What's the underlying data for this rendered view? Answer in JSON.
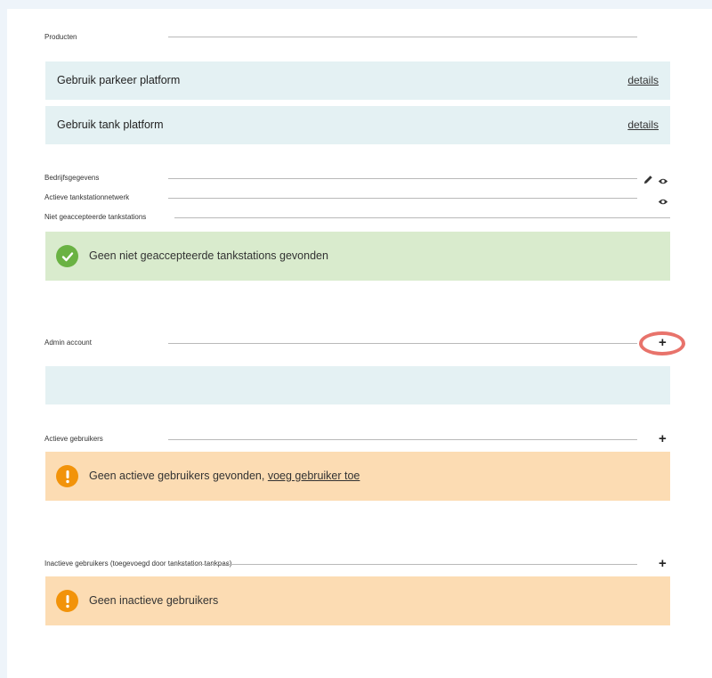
{
  "products": {
    "label": "Producten",
    "items": [
      {
        "name": "Gebruik parkeer platform",
        "link": "details"
      },
      {
        "name": "Gebruik tank platform",
        "link": "details"
      }
    ]
  },
  "company": {
    "label": "Bedrijfsgegevens"
  },
  "network": {
    "label": "Actieve tankstationnetwerk"
  },
  "unaccepted": {
    "label": "Niet geaccepteerde tankstations",
    "message": "Geen niet geaccepteerde tankstations gevonden"
  },
  "admin": {
    "label": "Admin account"
  },
  "active_users": {
    "label": "Actieve gebruikers",
    "message": "Geen actieve gebruikers gevonden,",
    "link": "voeg gebruiker toe"
  },
  "inactive_users": {
    "label": "Inactieve gebruikers (toegevoegd door tankstation tankpas)",
    "message": "Geen inactieve gebruikers"
  },
  "icons": {
    "edit": "pencil-icon",
    "view": "eye-icon",
    "add": "plus-icon",
    "success": "check-circle-icon",
    "warning": "exclamation-circle-icon"
  },
  "colors": {
    "success_bg": "#d9ebcd",
    "warning_bg": "#fcdcb3",
    "info_bg": "#e4f1f3",
    "highlight": "#e8736b"
  }
}
